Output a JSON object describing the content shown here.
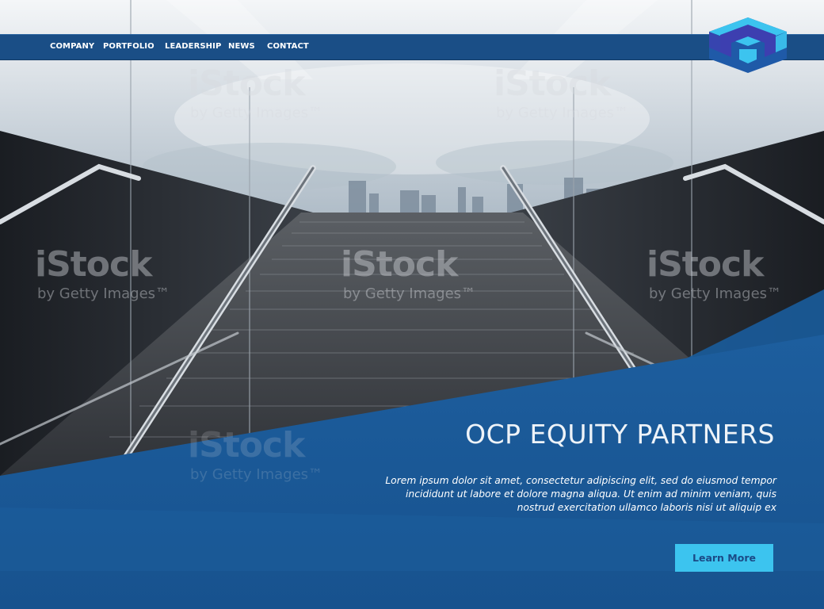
{
  "nav": {
    "items": [
      {
        "label": "COMPANY"
      },
      {
        "label": "PORTFOLIO"
      },
      {
        "label": "LEADERSHIP"
      },
      {
        "label": "NEWS"
      },
      {
        "label": "CONTACT"
      }
    ]
  },
  "logo": {
    "icon": "hexagon-box-logo",
    "colors": [
      "#3cc4ef",
      "#1f5aa8",
      "#3d3fb0"
    ]
  },
  "watermark": {
    "brand": "iStock",
    "byline": "by Getty Images™"
  },
  "hero": {
    "title": "OCP EQUITY PARTNERS",
    "description": "Lorem ipsum dolor sit amet, consectetur adipiscing elit, sed do eiusmod tempor incididunt ut labore et dolore magna aliqua. Ut enim ad minim veniam, quis nostrud exercitation ullamco laboris nisi ut aliquip ex",
    "cta_label": "Learn More"
  },
  "colors": {
    "nav_bg": "#1a4e86",
    "overlay_blue": "#1b5c9c",
    "cta_bg": "#3cc4ef",
    "cta_text": "#1b4a86"
  }
}
